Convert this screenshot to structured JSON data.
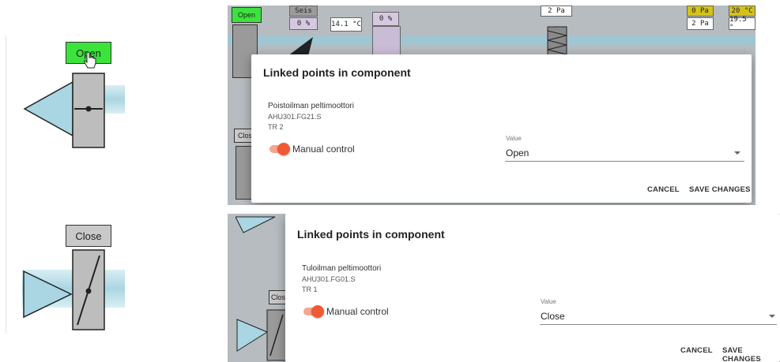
{
  "left_panel": {
    "open_button": "Open",
    "close_button": "Close"
  },
  "top_screenshot": {
    "background_labels": {
      "open_btn": "Open",
      "close_btn": "Clos",
      "sensor_seis_top": "Seis",
      "sensor_seis_bottom": "0 %",
      "sensor_temp": "14.1 °C",
      "sensor_purple": "0 %",
      "sensor_pa": "2 Pa",
      "sensor_yellow1_top": "0 Pa",
      "sensor_yellow1_bottom": "2 Pa",
      "sensor_yellow2_top": "20 °C",
      "sensor_yellow2_bottom": "19.5 °"
    },
    "dialog": {
      "title": "Linked points in component",
      "point_name": "Poistoilman peltimoottori",
      "point_id": "AHU301.FG21.S",
      "point_tr": "TR 2",
      "toggle_label": "Manual control",
      "field_label": "Value",
      "field_value": "Open",
      "cancel": "CANCEL",
      "save": "SAVE CHANGES"
    }
  },
  "bottom_screenshot": {
    "background_labels": {
      "close_btn": "Clos"
    },
    "dialog": {
      "title": "Linked points in component",
      "point_name": "Tuloilman peltimoottori",
      "point_id": "AHU301.FG01.S",
      "point_tr": "TR 1",
      "toggle_label": "Manual control",
      "field_label": "Value",
      "field_value": "Close",
      "cancel": "CANCEL",
      "save": "SAVE CHANGES"
    }
  },
  "colors": {
    "open_green": "#3de33d",
    "close_gray": "#c9c9c9",
    "duct_blue": "#a9d6e2",
    "toggle_accent": "#ef5a34"
  }
}
